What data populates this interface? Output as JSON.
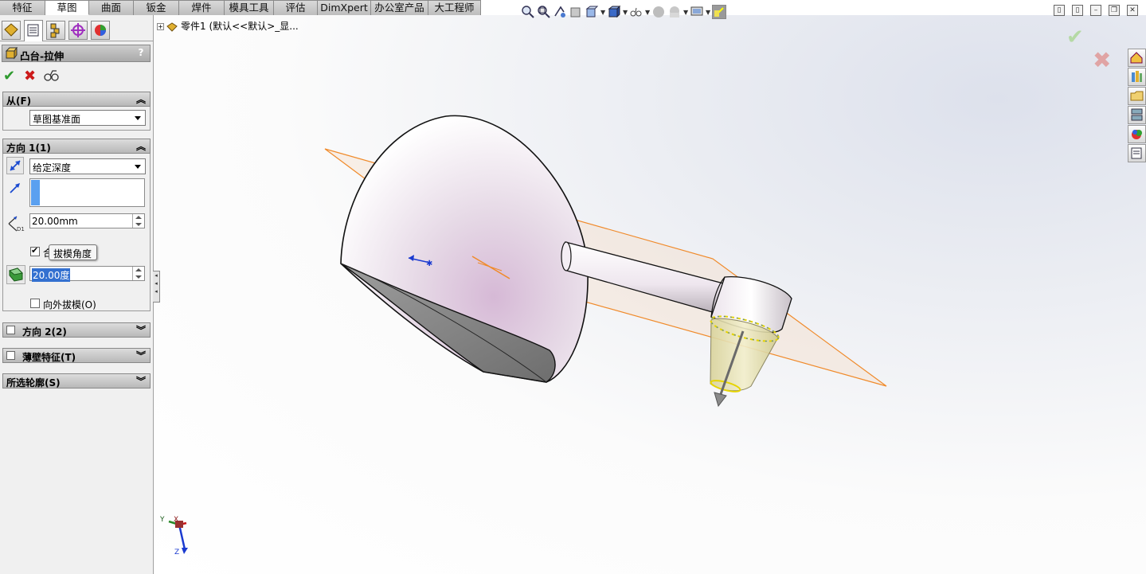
{
  "tabs": [
    {
      "label": "特征",
      "active": false
    },
    {
      "label": "草图",
      "active": true
    },
    {
      "label": "曲面",
      "active": false
    },
    {
      "label": "钣金",
      "active": false
    },
    {
      "label": "焊件",
      "active": false
    },
    {
      "label": "模具工具",
      "active": false
    },
    {
      "label": "评估",
      "active": false
    },
    {
      "label": "DimXpert",
      "active": false
    },
    {
      "label": "办公室产品",
      "active": false
    },
    {
      "label": "大工程师",
      "active": false
    }
  ],
  "property_manager": {
    "title": "凸台-拉伸",
    "help_label": "?",
    "from": {
      "header": "从(F)",
      "start_condition": "草图基准面"
    },
    "direction1": {
      "header": "方向 1(1)",
      "end_condition": "给定深度",
      "depth_value": "20.00mm",
      "depth_icon_label": "D1",
      "draft_checkbox_label": "合",
      "draft_checked": true,
      "draft_tooltip": "拔模角度",
      "draft_angle": "20.00度",
      "draft_outward_label": "向外拔模(O)",
      "draft_outward_checked": false
    },
    "direction2": {
      "header": "方向 2(2)",
      "checked": false
    },
    "thin_feature": {
      "header": "薄壁特征(T)",
      "checked": false
    },
    "selected_contours": {
      "header": "所选轮廓(S)"
    }
  },
  "viewport": {
    "tree_label": "零件1  (默认<<默认>_显...",
    "triad": {
      "x": "X",
      "y": "Y",
      "z": "Z"
    }
  },
  "colors": {
    "plane": "#f08a2a",
    "body": "#e9dfe9",
    "draft_cone": "#e6e0a8",
    "accept": "#2e9a2e",
    "cancel": "#cc1a1a"
  }
}
